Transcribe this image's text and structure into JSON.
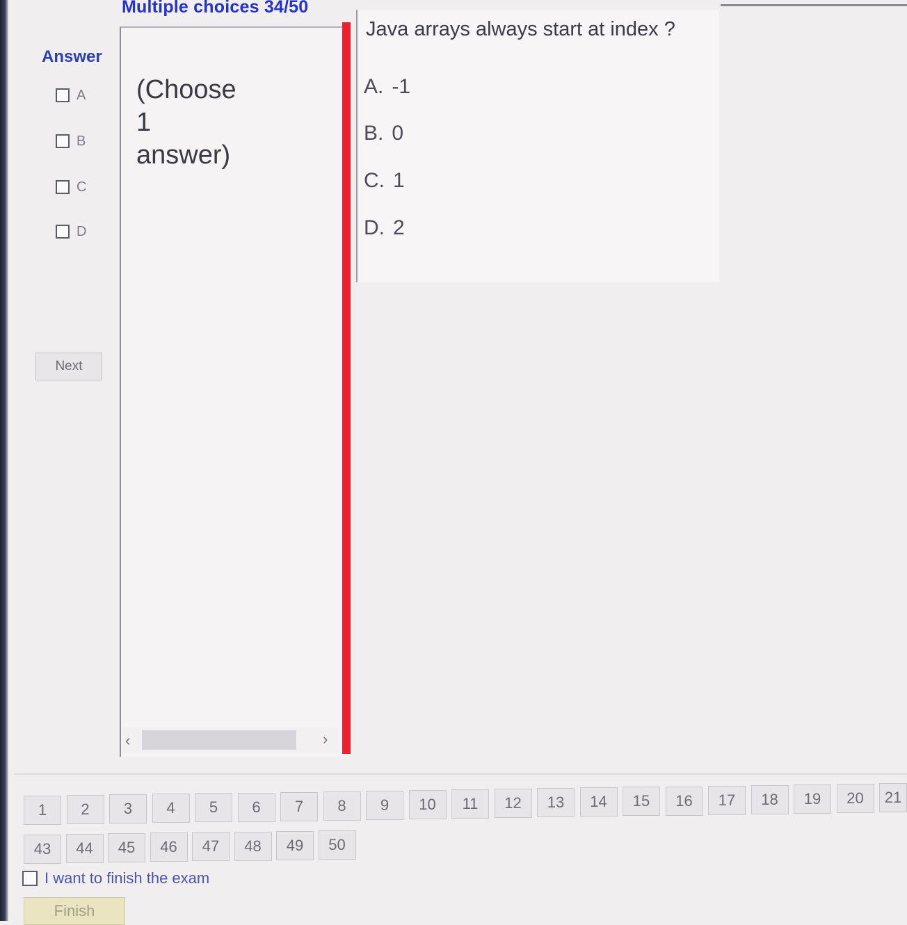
{
  "header": {
    "title": "Multiple choices 34/50"
  },
  "answer_panel": {
    "label": "Answer",
    "options": [
      "A",
      "B",
      "C",
      "D"
    ],
    "next_label": "Next"
  },
  "instruction": {
    "line1": "(Choose",
    "line2": "1",
    "line3": "answer)"
  },
  "question": {
    "text": "Java arrays always start at index ?",
    "choices": [
      {
        "letter": "A.",
        "value": "-1"
      },
      {
        "letter": "B.",
        "value": "0"
      },
      {
        "letter": "C.",
        "value": "1"
      },
      {
        "letter": "D.",
        "value": "2"
      }
    ]
  },
  "navigation": {
    "row1": [
      "1",
      "2",
      "3",
      "4",
      "5",
      "6",
      "7",
      "8",
      "9",
      "10",
      "11",
      "12",
      "13",
      "14",
      "15",
      "16",
      "17",
      "18",
      "19",
      "20",
      "21"
    ],
    "row2": [
      "43",
      "44",
      "45",
      "46",
      "47",
      "48",
      "49",
      "50"
    ]
  },
  "finish": {
    "checkbox_label": "I want to finish the exam",
    "button_label": "Finish"
  },
  "scroll": {
    "left_icon": "chevron-left-icon",
    "right_icon": "chevron-right-icon"
  }
}
